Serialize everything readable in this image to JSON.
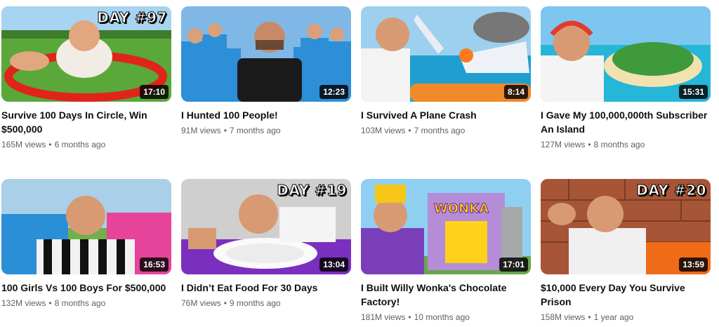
{
  "videos": [
    {
      "title": "Survive 100 Days In Circle, Win $500,000",
      "views": "165M views",
      "age": "6 months ago",
      "duration": "17:10",
      "overlay": "DAY #97",
      "thumb_icon": "circle-challenge-thumbnail"
    },
    {
      "title": "I Hunted 100 People!",
      "views": "91M views",
      "age": "7 months ago",
      "duration": "12:23",
      "overlay": "",
      "thumb_icon": "crowd-thumbnail"
    },
    {
      "title": "I Survived A Plane Crash",
      "views": "103M views",
      "age": "7 months ago",
      "duration": "8:14",
      "overlay": "",
      "thumb_icon": "plane-crash-thumbnail"
    },
    {
      "title": "I Gave My 100,000,000th Subscriber An Island",
      "views": "127M views",
      "age": "8 months ago",
      "duration": "15:31",
      "overlay": "",
      "thumb_icon": "island-thumbnail"
    },
    {
      "title": "100 Girls Vs 100 Boys For $500,000",
      "views": "132M views",
      "age": "8 months ago",
      "duration": "16:53",
      "overlay": "",
      "thumb_icon": "girls-vs-boys-thumbnail"
    },
    {
      "title": "I Didn’t Eat Food For 30 Days",
      "views": "76M views",
      "age": "9 months ago",
      "duration": "13:04",
      "overlay": "DAY #19",
      "thumb_icon": "empty-plate-thumbnail"
    },
    {
      "title": "I Built Willy Wonka's Chocolate Factory!",
      "views": "181M views",
      "age": "10 months ago",
      "duration": "17:01",
      "overlay": "WONKA",
      "thumb_icon": "wonka-factory-thumbnail"
    },
    {
      "title": "$10,000 Every Day You Survive Prison",
      "views": "158M views",
      "age": "1 year ago",
      "duration": "13:59",
      "overlay": "DAY #20",
      "thumb_icon": "prison-thumbnail"
    }
  ],
  "separator": "•"
}
